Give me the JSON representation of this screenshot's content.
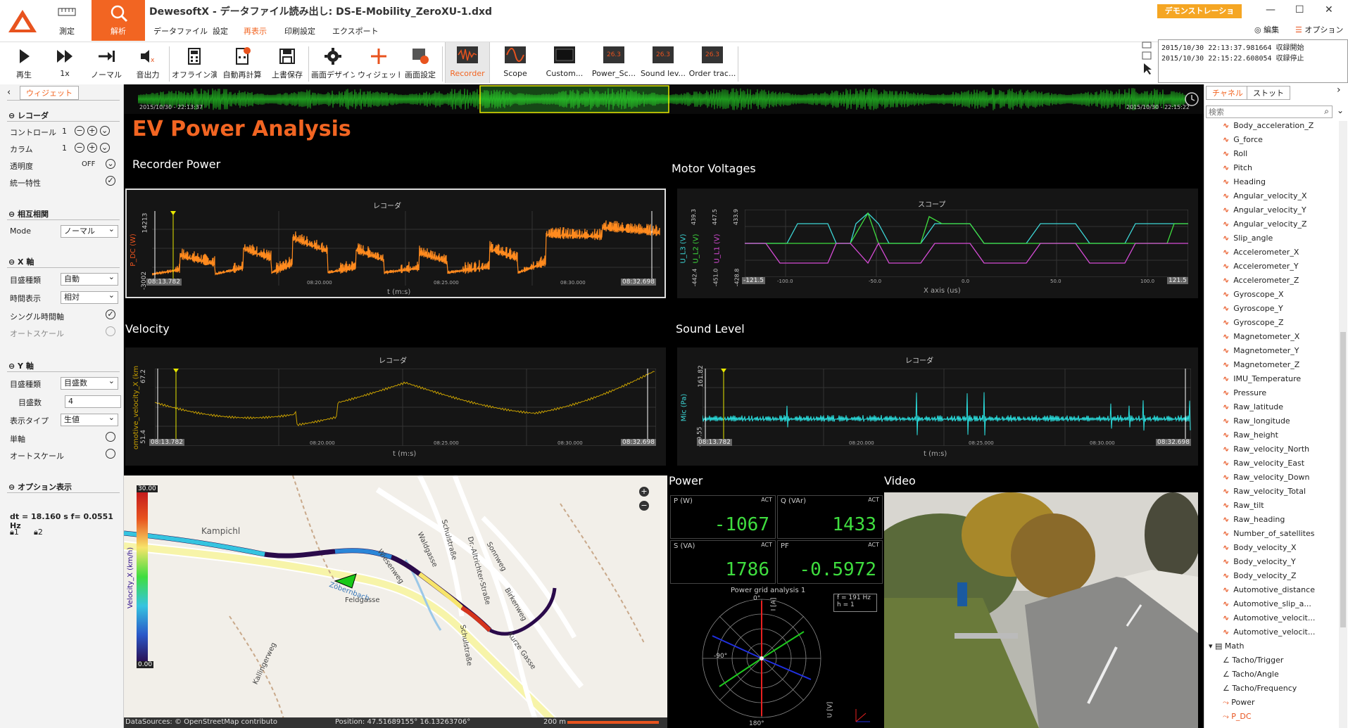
{
  "app": {
    "title": "DewesoftX - データファイル読み出し: DS-E-Mobility_ZeroXU-1.dxd",
    "top_buttons": [
      {
        "label": "測定"
      },
      {
        "label": "解析"
      }
    ],
    "menus": [
      "データファイル",
      "設定",
      "再表示",
      "印刷設定",
      "エクスポート"
    ],
    "active_menu": "再表示",
    "demo_label": "デモンストレーション...",
    "edit_label": "編集",
    "option_label": "オプション",
    "window_controls": [
      "—",
      "☐",
      "✕"
    ]
  },
  "toolbar": {
    "items": [
      {
        "label": "再生",
        "icon": "play-icon"
      },
      {
        "label": "1x",
        "icon": "fast-forward-icon"
      },
      {
        "label": "ノーマル",
        "icon": "step-icon"
      },
      {
        "label": "音出力",
        "icon": "speaker-icon"
      },
      {
        "label": "オフライン演算",
        "icon": "calculator-icon"
      },
      {
        "label": "自動再計算",
        "icon": "recalc-icon"
      },
      {
        "label": "上書保存",
        "icon": "save-icon"
      },
      {
        "label": "画面デザイン",
        "icon": "gear-icon"
      },
      {
        "label": "ウィジェット",
        "icon": "plus-icon"
      },
      {
        "label": "画面設定",
        "icon": "screen-settings-icon"
      },
      {
        "label": "Recorder",
        "icon": "recorder-icon"
      },
      {
        "label": "Scope",
        "icon": "scope-icon"
      },
      {
        "label": "Custom...",
        "icon": "custom-icon"
      },
      {
        "label": "Power_Sc...",
        "icon": "instrument-icon"
      },
      {
        "label": "Sound lev...",
        "icon": "instrument-icon"
      },
      {
        "label": "Order trac...",
        "icon": "instrument-icon"
      }
    ],
    "instr_value": "26.3",
    "selected": "Recorder"
  },
  "events": [
    "2015/10/30 22:13:37.981664 収録開始",
    "2015/10/30 22:15:22.608054 収録停止"
  ],
  "left": {
    "tab": "ウィジェット",
    "recorder_head": "レコーダ",
    "control_label": "コントロール",
    "control_value": "1",
    "column_label": "カラム",
    "column_value": "1",
    "transparency_label": "透明度",
    "transparency_value": "OFF",
    "uniform_label": "統一特性",
    "corr_head": "相互相関",
    "mode_label": "Mode",
    "mode_value": "ノーマル",
    "xaxis_head": "X 軸",
    "x_scale_label": "目盛種類",
    "x_scale_value": "自動",
    "time_disp_label": "時間表示",
    "time_disp_value": "相対",
    "single_time_label": "シングル時間軸",
    "autoscale_x_label": "オートスケール",
    "yaxis_head": "Y 軸",
    "y_scale_label": "目盛種類",
    "y_scale_value": "目盛数",
    "y_count_label": "目盛数",
    "y_count_value": "4",
    "disp_type_label": "表示タイプ",
    "disp_type_value": "生値",
    "single_axis_label": "単軸",
    "autoscale_y_label": "オートスケール",
    "opt_head": "オプション表示",
    "cursor_info": "dt = 18.160 s  f= 0.0551 Hz",
    "lock1": "1",
    "lock2": "2"
  },
  "overview": {
    "start": "2015/10/30 - 22:13:37",
    "end": "2015/10/30 - 22:15:22"
  },
  "main": {
    "title": "EV Power Analysis",
    "recorder_power": {
      "title": "Recorder Power",
      "chart_title": "レコーダ",
      "ylabel": "P_DC (W)",
      "ymax": "14213",
      "ymin": "-3002",
      "xlabel": "t (m:s)",
      "xstart": "08:13.782",
      "xend": "08:32.698",
      "ticks": [
        "08:20.000",
        "08:25.000",
        "08:30.000"
      ]
    },
    "motor_voltages": {
      "title": "Motor Voltages",
      "chart_title": "スコープ",
      "xlabel": "X axis (us)",
      "ylabels": [
        "U_L3 (V)",
        "U_L2 (V)",
        "U_L1 (V)"
      ],
      "ytops": [
        "439.3",
        "447.5",
        "433.9"
      ],
      "ybots": [
        "-442.4",
        "-451.0",
        "-428.8"
      ],
      "xstart": "-121.5",
      "xend": "121.5",
      "ticks": [
        "-100.0",
        "-50.0",
        "0.0",
        "50.0",
        "100.0"
      ]
    },
    "velocity": {
      "title": "Velocity",
      "chart_title": "レコーダ",
      "ylabel": "omotive_velocity_X (km",
      "ymax": "67.2",
      "ymin": "51.4",
      "xlabel": "t (m:s)",
      "xstart": "08:13.782",
      "xend": "08:32.698",
      "ticks": [
        "08:20.000",
        "08:25.000",
        "08:30.000"
      ]
    },
    "sound": {
      "title": "Sound Level",
      "chart_title": "レコーダ",
      "ylabel": "Mic (Pa)",
      "ymax": "161.82",
      "ymin": "-49.55",
      "xlabel": "t (m:s)",
      "xstart": "08:13.782",
      "xend": "08:32.698",
      "ticks": [
        "08:20.000",
        "08:25.000",
        "08:30.000"
      ]
    },
    "map": {
      "scale_top": "30.00",
      "scale_bot": "0.00",
      "scale_label": "Velocity_X (km/h)",
      "place1": "Kampichl",
      "place2": "Zöbernbach",
      "place3": "Feldgasse",
      "place4": "Wiesenweg",
      "place5": "Waldgasse",
      "place6": "Schulstraße",
      "place7": "Dr.-Altrichter-Straße",
      "place8": "Sonnweg",
      "place9": "Birkenweg",
      "place10": "Kurze Gasse",
      "place11": "Kallingerweg",
      "place12": "Schulstraße",
      "source": "DataSources: © OpenStreetMap contributo",
      "position": "Position: 47.51689155° 16.13263706°",
      "scale": "200 m"
    },
    "power": {
      "title": "Power",
      "tiles": [
        {
          "name": "P (W)",
          "act": "ACT",
          "value": "-1067"
        },
        {
          "name": "Q (VAr)",
          "act": "ACT",
          "value": "1433"
        },
        {
          "name": "S (VA)",
          "act": "ACT",
          "value": "1786"
        },
        {
          "name": "PF",
          "act": "ACT",
          "value": "-0.5972"
        }
      ],
      "grid_title": "Power grid analysis 1",
      "freq": "f = 191 Hz",
      "harm": "h = 1",
      "angle0": "0°",
      "angle90": "-90°",
      "angle180": "180°",
      "ulabel": "U [V]",
      "ilabel": "I [A]"
    },
    "video": {
      "title": "Video"
    }
  },
  "right": {
    "tabs": [
      "チャネル",
      "ストット"
    ],
    "search_placeholder": "検索",
    "channels": [
      "Body_acceleration_Z",
      "G_force",
      "Roll",
      "Pitch",
      "Heading",
      "Angular_velocity_X",
      "Angular_velocity_Y",
      "Angular_velocity_Z",
      "Slip_angle",
      "Accelerometer_X",
      "Accelerometer_Y",
      "Accelerometer_Z",
      "Gyroscope_X",
      "Gyroscope_Y",
      "Gyroscope_Z",
      "Magnetometer_X",
      "Magnetometer_Y",
      "Magnetometer_Z",
      "IMU_Temperature",
      "Pressure",
      "Raw_latitude",
      "Raw_longitude",
      "Raw_height",
      "Raw_velocity_North",
      "Raw_velocity_East",
      "Raw_velocity_Down",
      "Raw_velocity_Total",
      "Raw_tilt",
      "Raw_heading",
      "Number_of_satellites",
      "Body_velocity_X",
      "Body_velocity_Y",
      "Body_velocity_Z",
      "Automotive_distance",
      "Automotive_slip_a...",
      "Automotive_velocit...",
      "Automotive_velocit..."
    ],
    "math_group": "Math",
    "math_items": [
      "Tacho/Trigger",
      "Tacho/Angle",
      "Tacho/Frequency",
      "Power",
      "P_DC"
    ],
    "colors": {
      "accent": "#f26522",
      "wave": "#e8531e",
      "selected": "#f26522"
    }
  }
}
